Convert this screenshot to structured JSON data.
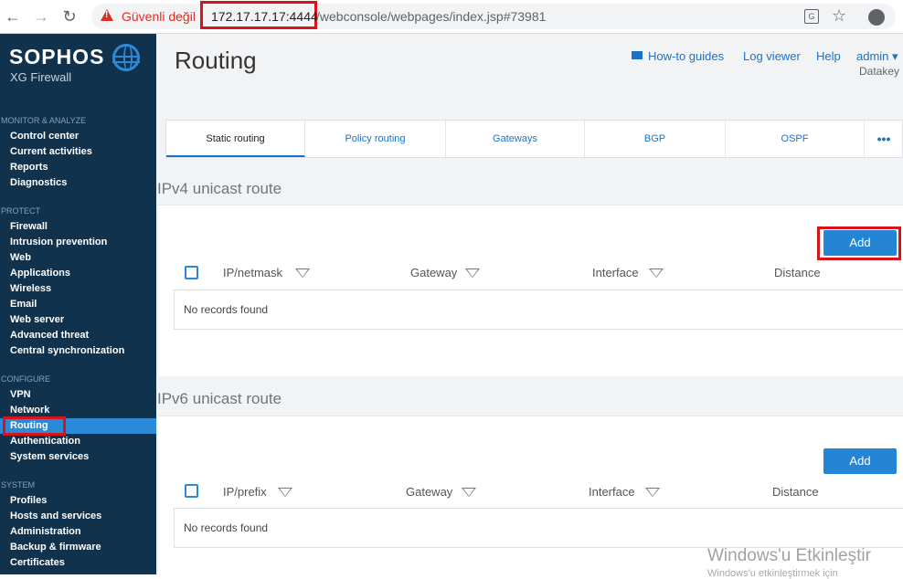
{
  "browser": {
    "insecure_label": "Güvenli değil",
    "url_host": "172.17.17.17:4444",
    "url_rest": "/webconsole/webpages/index.jsp#73981"
  },
  "sidebar": {
    "logo": "SOPHOS",
    "logo_sub": "XG Firewall",
    "sections": [
      {
        "title": "MONITOR & ANALYZE",
        "items": [
          "Control center",
          "Current activities",
          "Reports",
          "Diagnostics"
        ]
      },
      {
        "title": "PROTECT",
        "items": [
          "Firewall",
          "Intrusion prevention",
          "Web",
          "Applications",
          "Wireless",
          "Email",
          "Web server",
          "Advanced threat",
          "Central synchronization"
        ]
      },
      {
        "title": "CONFIGURE",
        "items": [
          "VPN",
          "Network",
          "Routing",
          "Authentication",
          "System services"
        ]
      },
      {
        "title": "SYSTEM",
        "items": [
          "Profiles",
          "Hosts and services",
          "Administration",
          "Backup & firmware",
          "Certificates"
        ]
      }
    ],
    "active_item": "Routing"
  },
  "header": {
    "title": "Routing",
    "links": {
      "howto": "How-to guides",
      "log": "Log viewer",
      "help": "Help"
    },
    "user": "admin",
    "company": "Datakey"
  },
  "tabs": [
    "Static routing",
    "Policy routing",
    "Gateways",
    "BGP",
    "OSPF",
    "•••"
  ],
  "ipv4": {
    "title": "IPv4 unicast route",
    "add_label": "Add",
    "columns": [
      "IP/netmask",
      "Gateway",
      "Interface",
      "Distance"
    ],
    "empty": "No records found"
  },
  "ipv6": {
    "title": "IPv6 unicast route",
    "add_label": "Add",
    "columns": [
      "IP/prefix",
      "Gateway",
      "Interface",
      "Distance"
    ],
    "empty": "No records found"
  },
  "watermark": {
    "line1": "Windows'u Etkinleştir",
    "line2": "Windows'u etkinleştirmek için"
  }
}
